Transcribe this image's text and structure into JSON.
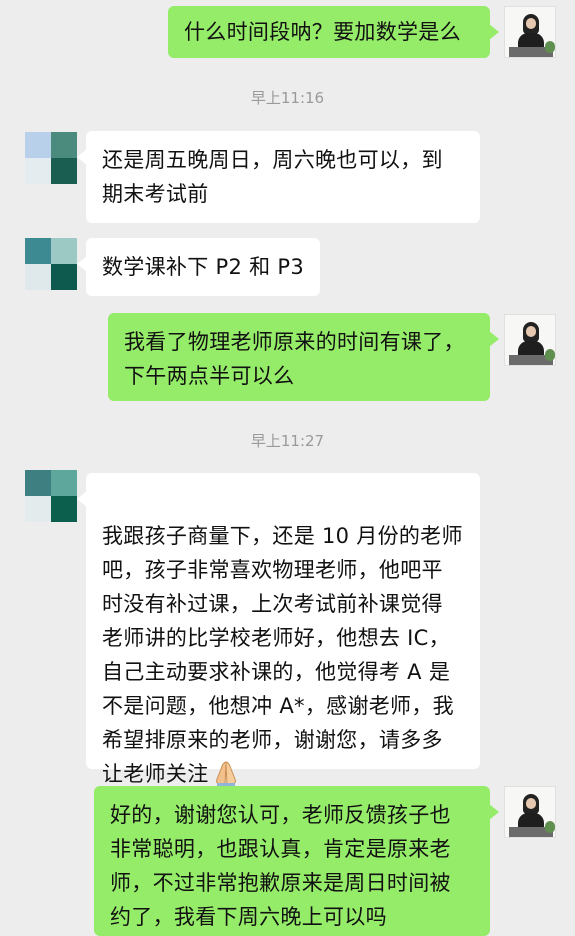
{
  "colors": {
    "background": "#ededed",
    "incoming_bubble": "#ffffff",
    "outgoing_bubble": "#95ec69",
    "timestamp_text": "#9a9a9a"
  },
  "messages": {
    "msg1": {
      "text": "什么时间段呐？要加数学是么"
    },
    "time1": {
      "text": "早上11:16"
    },
    "msg2": {
      "text": "还是周五晚周日，周六晚也可以，到\n期末考试前"
    },
    "msg3": {
      "text": "数学课补下 P2 和 P3"
    },
    "msg4": {
      "text": "我看了物理老师原来的时间有课了，\n下午两点半可以么"
    },
    "time2": {
      "text": "早上11:27"
    },
    "msg5": {
      "text": "我跟孩子商量下，还是 10 月份的老师\n吧，孩子非常喜欢物理老师，他吧平\n时没有补过课，上次考试前补课觉得\n老师讲的比学校老师好，他想去 IC，\n自己主动要求补课的，他觉得考 A 是\n不是问题，他想冲 A*，感谢老师，我\n希望排原来的老师，谢谢您，请多多\n让老师关注",
      "emoji": "folded-hands-emoji"
    },
    "msg6": {
      "text": "好的，谢谢您认可，老师反馈孩子也\n非常聪明，也跟认真，肯定是原来老\n师，不过非常抱歉原来是周日时间被\n约了，我看下周六晚上可以吗"
    }
  }
}
